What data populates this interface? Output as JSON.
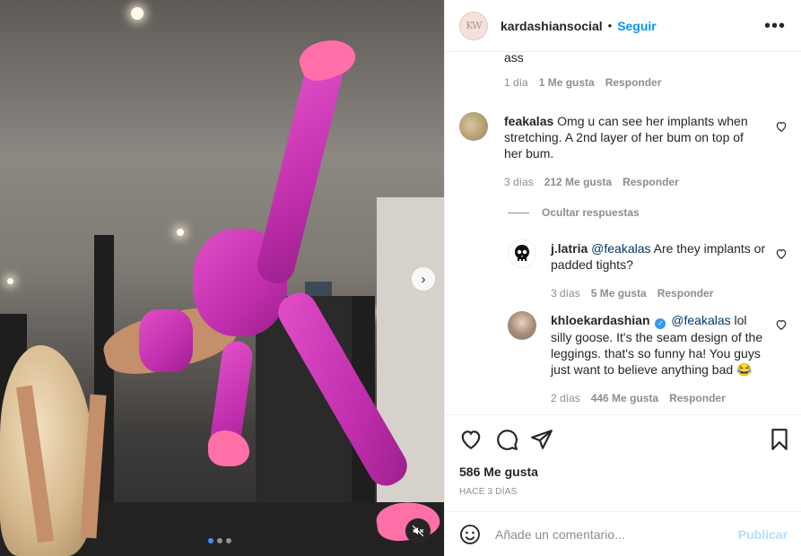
{
  "header": {
    "avatar_text": "KW",
    "username": "kardashiansocial",
    "separator": "•",
    "follow_label": "Seguir",
    "more_label": "•••"
  },
  "comments": [
    {
      "text": "ass",
      "time": "1 día",
      "likes": "1 Me gusta",
      "reply": "Responder"
    },
    {
      "username": "feakalas",
      "text": "Omg u can see her implants when stretching. A 2nd layer of her bum on top of her bum.",
      "time": "3 días",
      "likes": "212 Me gusta",
      "reply": "Responder"
    }
  ],
  "replies_toggle": "Ocultar respuestas",
  "replies": [
    {
      "username": "j.latria",
      "mention": "@feakalas",
      "text": " Are they implants or padded tights?",
      "time": "3 días",
      "likes": "5 Me gusta",
      "reply": "Responder"
    },
    {
      "username": "khloekardashian",
      "verified": "✓",
      "mention": "@feakalas",
      "text": " lol silly goose. It's the seam design of the leggings. that's so funny ha! You guys just want to believe anything bad 😂",
      "time": "2 días",
      "likes": "446 Me gusta",
      "reply": "Responder"
    }
  ],
  "post": {
    "likes": "586 Me gusta",
    "time_ago": "HACE 3 DÍAS"
  },
  "add_comment": {
    "placeholder": "Añade un comentario...",
    "publish_label": "Publicar"
  },
  "media": {
    "next_label": "›",
    "carousel_total": 3,
    "carousel_active": 1
  },
  "colors": {
    "accent": "#0095f6",
    "legging_pink": "#c12fae"
  }
}
